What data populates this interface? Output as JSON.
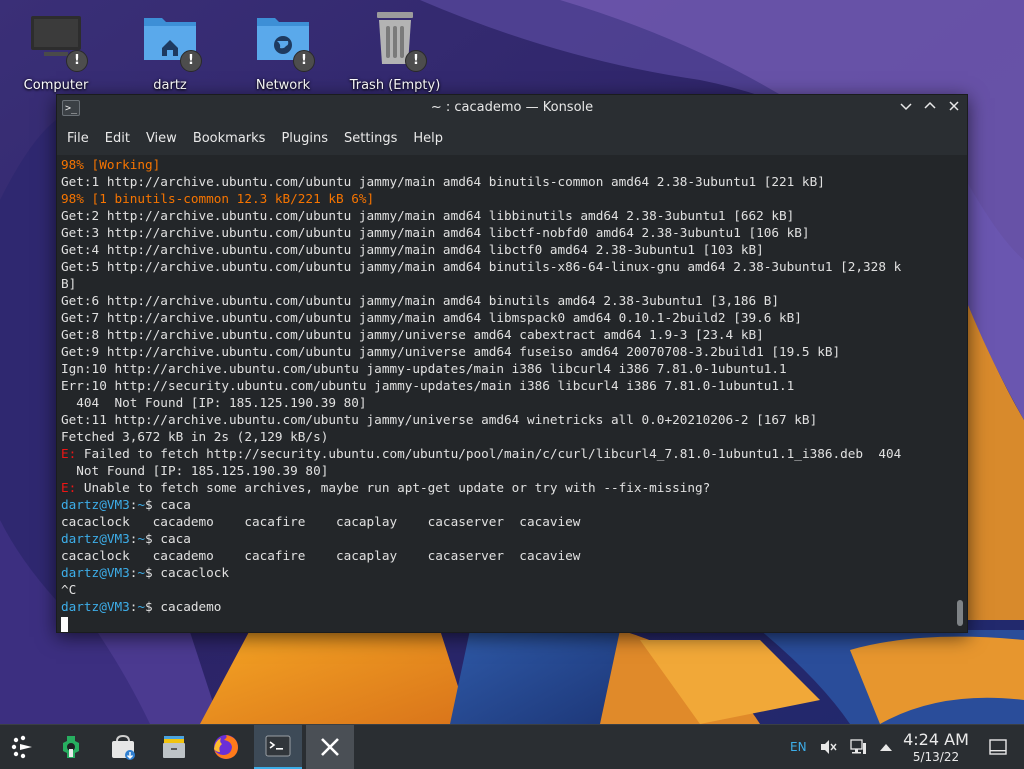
{
  "desktop": {
    "icons": [
      {
        "label": "Computer"
      },
      {
        "label": "dartz"
      },
      {
        "label": "Network"
      },
      {
        "label": "Trash (Empty)"
      }
    ],
    "badge_glyph": "!"
  },
  "window": {
    "title": "~ : cacademo — Konsole",
    "menu": [
      "File",
      "Edit",
      "View",
      "Bookmarks",
      "Plugins",
      "Settings",
      "Help"
    ]
  },
  "terminal": {
    "prompt_user": "dartz@VM3",
    "prompt_sep": ":",
    "prompt_path": "~",
    "prompt_sign": "$ ",
    "err_prefix": "E:",
    "lines": [
      {
        "t": "orange",
        "text": "98% [Working]"
      },
      {
        "t": "plain",
        "text": "Get:1 http://archive.ubuntu.com/ubuntu jammy/main amd64 binutils-common amd64 2.38-3ubuntu1 [221 kB]"
      },
      {
        "t": "orange",
        "text": "98% [1 binutils-common 12.3 kB/221 kB 6%]"
      },
      {
        "t": "plain",
        "text": "Get:2 http://archive.ubuntu.com/ubuntu jammy/main amd64 libbinutils amd64 2.38-3ubuntu1 [662 kB]"
      },
      {
        "t": "plain",
        "text": "Get:3 http://archive.ubuntu.com/ubuntu jammy/main amd64 libctf-nobfd0 amd64 2.38-3ubuntu1 [106 kB]"
      },
      {
        "t": "plain",
        "text": "Get:4 http://archive.ubuntu.com/ubuntu jammy/main amd64 libctf0 amd64 2.38-3ubuntu1 [103 kB]"
      },
      {
        "t": "plain",
        "text": "Get:5 http://archive.ubuntu.com/ubuntu jammy/main amd64 binutils-x86-64-linux-gnu amd64 2.38-3ubuntu1 [2,328 k"
      },
      {
        "t": "plain",
        "text": "B]"
      },
      {
        "t": "plain",
        "text": "Get:6 http://archive.ubuntu.com/ubuntu jammy/main amd64 binutils amd64 2.38-3ubuntu1 [3,186 B]"
      },
      {
        "t": "plain",
        "text": "Get:7 http://archive.ubuntu.com/ubuntu jammy/main amd64 libmspack0 amd64 0.10.1-2build2 [39.6 kB]"
      },
      {
        "t": "plain",
        "text": "Get:8 http://archive.ubuntu.com/ubuntu jammy/universe amd64 cabextract amd64 1.9-3 [23.4 kB]"
      },
      {
        "t": "plain",
        "text": "Get:9 http://archive.ubuntu.com/ubuntu jammy/universe amd64 fuseiso amd64 20070708-3.2build1 [19.5 kB]"
      },
      {
        "t": "plain",
        "text": "Ign:10 http://archive.ubuntu.com/ubuntu jammy-updates/main i386 libcurl4 i386 7.81.0-1ubuntu1.1"
      },
      {
        "t": "plain",
        "text": "Err:10 http://security.ubuntu.com/ubuntu jammy-updates/main i386 libcurl4 i386 7.81.0-1ubuntu1.1"
      },
      {
        "t": "plain",
        "text": "  404  Not Found [IP: 185.125.190.39 80]"
      },
      {
        "t": "plain",
        "text": "Get:11 http://archive.ubuntu.com/ubuntu jammy/universe amd64 winetricks all 0.0+20210206-2 [167 kB]"
      },
      {
        "t": "plain",
        "text": "Fetched 3,672 kB in 2s (2,129 kB/s)"
      },
      {
        "t": "err",
        "text": " Failed to fetch http://security.ubuntu.com/ubuntu/pool/main/c/curl/libcurl4_7.81.0-1ubuntu1.1_i386.deb  404"
      },
      {
        "t": "plain",
        "text": "  Not Found [IP: 185.125.190.39 80]"
      },
      {
        "t": "err",
        "text": " Unable to fetch some archives, maybe run apt-get update or try with --fix-missing?"
      },
      {
        "t": "prompt",
        "text": "caca"
      },
      {
        "t": "plain",
        "text": "cacaclock   cacademo    cacafire    cacaplay    cacaserver  cacaview"
      },
      {
        "t": "prompt",
        "text": "caca"
      },
      {
        "t": "plain",
        "text": "cacaclock   cacademo    cacafire    cacaplay    cacaserver  cacaview"
      },
      {
        "t": "prompt",
        "text": "cacaclock"
      },
      {
        "t": "plain",
        "text": "^C"
      },
      {
        "t": "prompt",
        "text": "cacademo"
      },
      {
        "t": "cursor",
        "text": ""
      }
    ]
  },
  "taskbar": {
    "language": "EN",
    "time": "4:24 AM",
    "date": "5/13/22"
  },
  "colors": {
    "accent": "#3daee9",
    "orange": "#f67400",
    "error": "#ed1515",
    "prompt_green": "#1cdc9a"
  }
}
